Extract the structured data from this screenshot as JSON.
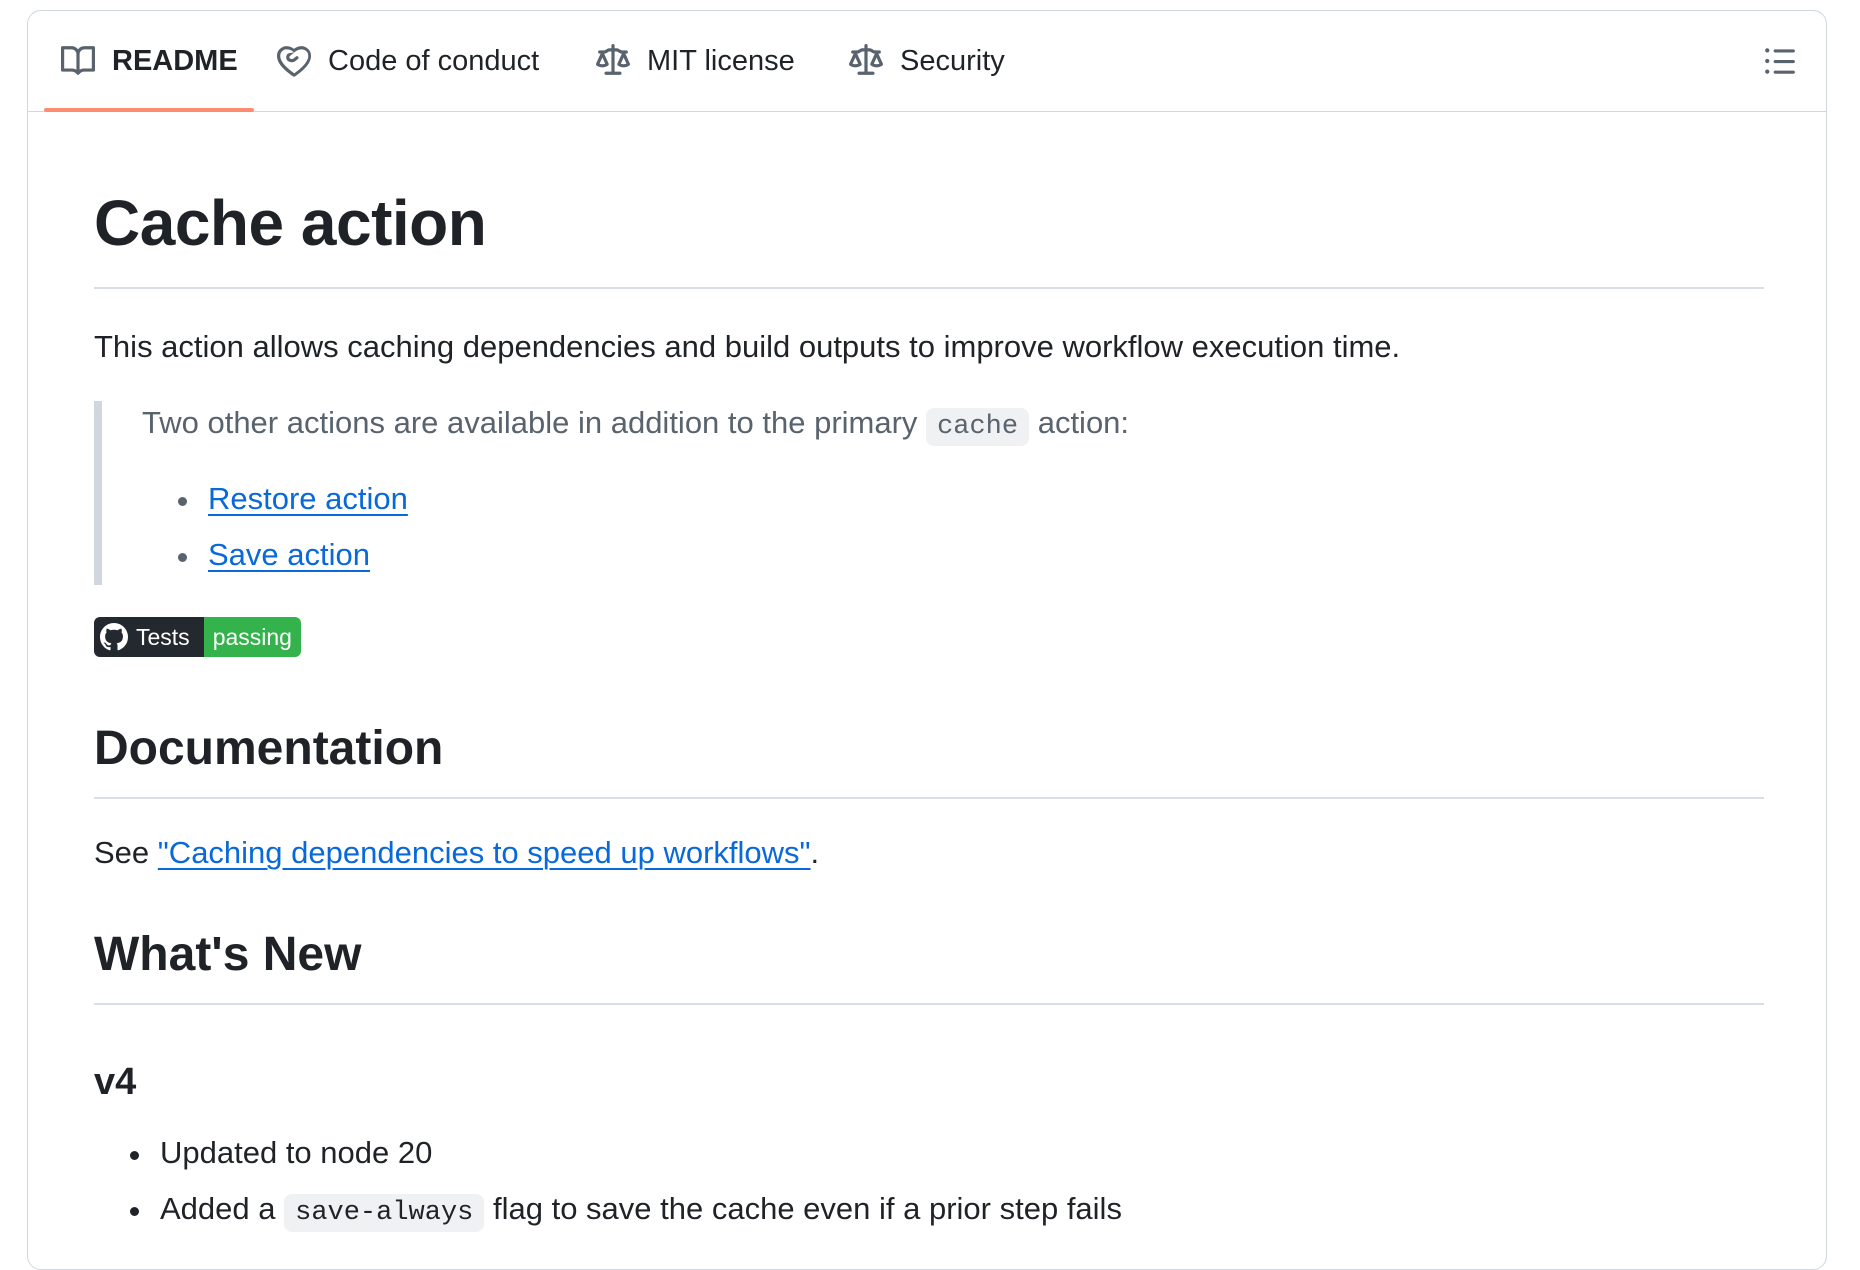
{
  "tabs": [
    {
      "label": "README",
      "icon": "book-icon",
      "active": true
    },
    {
      "label": "Code of conduct",
      "icon": "code-of-conduct-icon",
      "active": false
    },
    {
      "label": "MIT license",
      "icon": "law-icon",
      "active": false
    },
    {
      "label": "Security",
      "icon": "law-icon",
      "active": false
    }
  ],
  "toc_icon": "list-unordered-icon",
  "readme": {
    "title": "Cache action",
    "intro": "This action allows caching dependencies and build outputs to improve workflow execution time.",
    "note": {
      "prefix": "Two other actions are available in addition to the primary",
      "code": "cache",
      "suffix": "action:",
      "links": [
        "Restore action",
        "Save action"
      ]
    },
    "badge": {
      "label": "Tests",
      "status": "passing",
      "status_color": "#34b34c"
    },
    "documentation": {
      "heading": "Documentation",
      "prefix": "See",
      "link": "\"Caching dependencies to speed up workflows\"",
      "suffix": "."
    },
    "whats_new": {
      "heading": "What's New",
      "version": "v4",
      "items": [
        {
          "text": "Updated to node 20"
        },
        {
          "prefix": "Added a",
          "code": "save-always",
          "suffix": "flag to save the cache even if a prior step fails"
        }
      ]
    }
  },
  "colors": {
    "link": "#0969da",
    "active_tab_underline": "#fd8c73",
    "border": "#d0d7de",
    "muted_text": "#59636e"
  }
}
